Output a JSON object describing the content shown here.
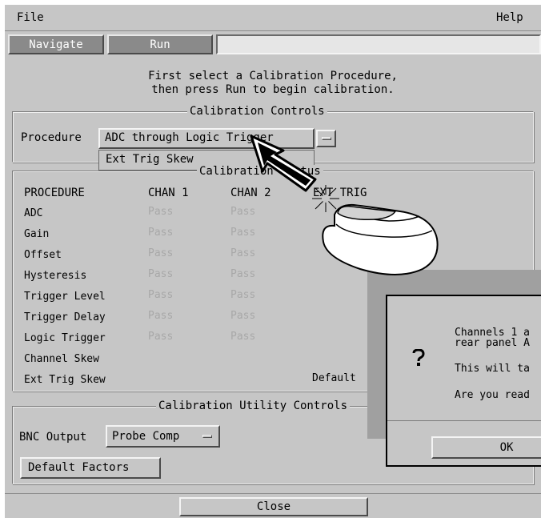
{
  "menubar": {
    "file": "File",
    "help": "Help"
  },
  "tabs": {
    "navigate": "Navigate",
    "run": "Run"
  },
  "instructions": [
    "First select a Calibration Procedure,",
    "then press Run to begin calibration."
  ],
  "controls": {
    "title": "Calibration Controls",
    "procedure_label": "Procedure",
    "procedure_value": "ADC through Logic Trigger",
    "dropdown_option": "Ext Trig Skew"
  },
  "status": {
    "title": "Calibration Status",
    "headers": [
      "PROCEDURE",
      "CHAN 1",
      "CHAN 2",
      "EXT TRIG"
    ],
    "rows": [
      {
        "name": "ADC",
        "ch1": "Pass",
        "ch2": "Pass"
      },
      {
        "name": "Gain",
        "ch1": "Pass",
        "ch2": "Pass"
      },
      {
        "name": "Offset",
        "ch1": "Pass",
        "ch2": "Pass"
      },
      {
        "name": "Hysteresis",
        "ch1": "Pass",
        "ch2": "Pass"
      },
      {
        "name": "Trigger Level",
        "ch1": "Pass",
        "ch2": "Pass"
      },
      {
        "name": "Trigger Delay",
        "ch1": "Pass",
        "ch2": "Pass"
      },
      {
        "name": "Logic Trigger",
        "ch1": "Pass",
        "ch2": "Pass"
      },
      {
        "name": "Channel Skew",
        "ch1": "",
        "ch2": ""
      },
      {
        "name": "Ext Trig Skew",
        "ch1": "",
        "ch2": ""
      }
    ],
    "ext_trig_default": "Default"
  },
  "utility": {
    "title": "Calibration Utility Controls",
    "bnc_label": "BNC Output",
    "bnc_value": "Probe Comp",
    "default_factors": "Default Factors"
  },
  "close": "Close",
  "dialog": {
    "line1": "Channels 1 a",
    "line2": "rear panel A",
    "line3": "This will ta",
    "line4": "Are you read",
    "ok": "OK"
  },
  "colors": {
    "panel": "#c6c6c6",
    "tab_active": "#8a8a8a",
    "pass_text": "#a8a8a8",
    "dialog_shadow": "#a0a0a0"
  },
  "icons": [
    "pointer-arrow-icon",
    "mouse-icon",
    "click-spark-icon",
    "question-icon"
  ]
}
